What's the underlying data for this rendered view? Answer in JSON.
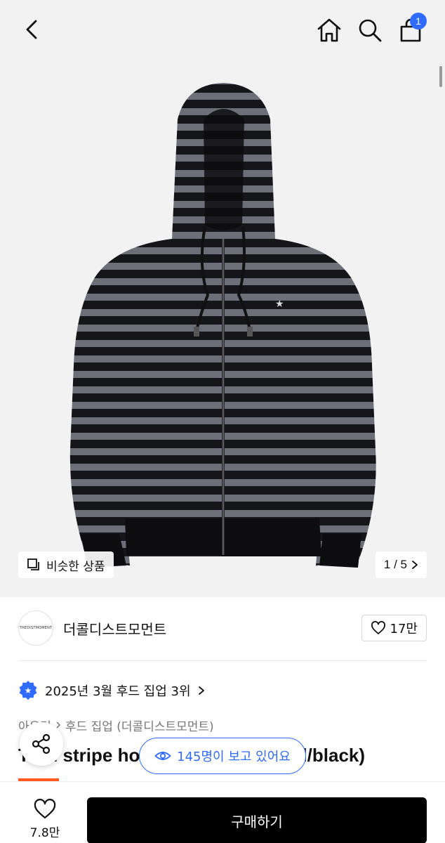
{
  "header": {
    "back_icon": "chevron-left-icon",
    "home_icon": "home-icon",
    "search_icon": "search-icon",
    "cart_icon": "shopping-bag-icon",
    "cart_count": "1",
    "badge_color": "#2f6bff"
  },
  "gallery": {
    "similar_label": "비슷한 상품",
    "page_indicator": "1 / 5",
    "background": "#f2f2f2"
  },
  "store": {
    "logo_text": "THEDISTMOMENT",
    "name": "더콜디스트모먼트",
    "likes": "17만"
  },
  "ranking": {
    "text": "2025년 3월 후드 집업 3위"
  },
  "breadcrumb": {
    "first": "아우터",
    "second": "후드 집업 (더콜디스트모먼트)"
  },
  "product": {
    "title": "TCM stripe hood zip-up (charcoal/black)"
  },
  "viewers": {
    "text": "145명이 보고 있어요",
    "color": "#2f6bff"
  },
  "bottom": {
    "wish_count": "7.8만",
    "buy_label": "구매하기",
    "accent": "#ff5a1f"
  }
}
